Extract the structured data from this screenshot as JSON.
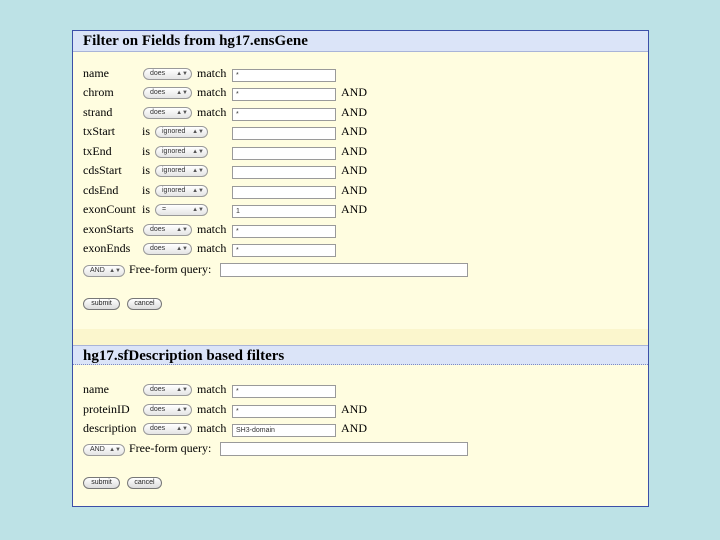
{
  "section1": {
    "title": "Filter on Fields from hg17.ensGene",
    "rows": [
      {
        "name": "name",
        "op": "does",
        "verb": "match",
        "value": "*",
        "and": ""
      },
      {
        "name": "chrom",
        "op": "does",
        "verb": "match",
        "value": "*",
        "and": "AND"
      },
      {
        "name": "strand",
        "op": "does",
        "verb": "match",
        "value": "*",
        "and": "AND"
      },
      {
        "name": "txStart",
        "op": "ignored",
        "verb": "is",
        "value": "",
        "and": "AND"
      },
      {
        "name": "txEnd",
        "op": "ignored",
        "verb": "is",
        "value": "",
        "and": "AND"
      },
      {
        "name": "cdsStart",
        "op": "ignored",
        "verb": "is",
        "value": "",
        "and": "AND"
      },
      {
        "name": "cdsEnd",
        "op": "ignored",
        "verb": "is",
        "value": "",
        "and": "AND"
      },
      {
        "name": "exonCount",
        "op": "=",
        "verb": "is",
        "value": "1",
        "and": "AND"
      },
      {
        "name": "exonStarts",
        "op": "does",
        "verb": "match",
        "value": "*",
        "and": ""
      },
      {
        "name": "exonEnds",
        "op": "does",
        "verb": "match",
        "value": "*",
        "and": ""
      }
    ],
    "freeform_op": "AND",
    "freeform_label": "Free-form query:",
    "freeform_value": "",
    "submit_label": "submit",
    "cancel_label": "cancel"
  },
  "section2": {
    "title": "hg17.sfDescription based filters",
    "rows": [
      {
        "name": "name",
        "op": "does",
        "verb": "match",
        "value": "*",
        "and": ""
      },
      {
        "name": "proteinID",
        "op": "does",
        "verb": "match",
        "value": "*",
        "and": "AND"
      },
      {
        "name": "description",
        "op": "does",
        "verb": "match",
        "value": "SH3-domain",
        "and": "AND"
      }
    ],
    "freeform_op": "AND",
    "freeform_label": "Free-form query:",
    "freeform_value": "",
    "submit_label": "submit",
    "cancel_label": "cancel"
  },
  "icons": {
    "dropdown_arrow": "up-down-arrows-icon"
  },
  "colors": {
    "background": "#bde2e6",
    "panel": "#fffde0",
    "header": "#dbe4f8",
    "border": "#3c4fa8"
  }
}
